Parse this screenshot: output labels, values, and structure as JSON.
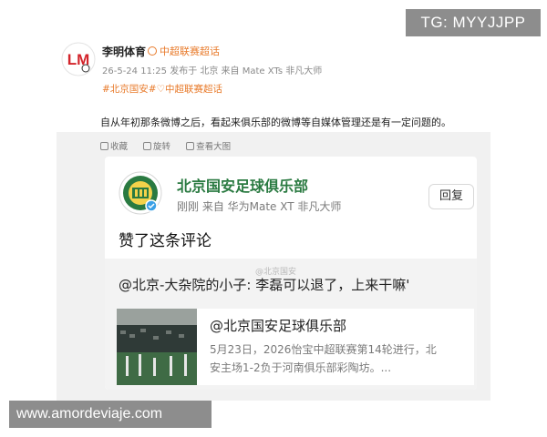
{
  "overlay": {
    "tg_label": "TG: MYYJJPP",
    "site_label": "www.amordeviaje.com"
  },
  "post": {
    "avatar_icon": "lm-logo-icon",
    "avatar_text": "LM",
    "author": "李明体育",
    "author_tag": "中超联赛超话",
    "meta": "26-5-24 11:25 发布于 北京 来自 Mate XTs 非凡大师",
    "hashtags": "#北京国安#♡中超联赛超话",
    "text": "自从年初那条微博之后，看起来俱乐部的微博等自媒体管理还是有一定问题的。",
    "actions": [
      {
        "icon": "bookmark-icon",
        "label": "收藏"
      },
      {
        "icon": "repost-icon",
        "label": "旋转"
      },
      {
        "icon": "enlarge-icon",
        "label": "查看大图"
      }
    ]
  },
  "screenshot_card": {
    "club_name": "北京国安足球俱乐部",
    "club_meta": "刚刚  来自 华为Mate XT 非凡大师",
    "reply_label": "回复",
    "liked_text": "赞了这条评论",
    "watermark": "@北京国安",
    "comment": "@北京-大杂院的小子: 李磊可以退了，上来干嘛'",
    "inner": {
      "title": "@北京国安足球俱乐部",
      "desc_line1": "5月23日，2026怡宝中超联赛第14轮进行，北",
      "desc_line2": "安主场1-2负于河南俱乐部彩陶坊。..."
    }
  },
  "colors": {
    "accent_orange": "#e87a2a",
    "club_green": "#2a7a41",
    "overlay_gray": "#8d8d8d"
  }
}
